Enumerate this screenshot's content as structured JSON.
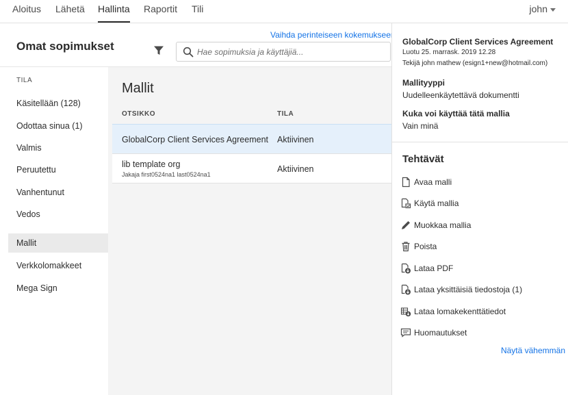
{
  "nav": {
    "tabs": [
      {
        "label": "Aloitus"
      },
      {
        "label": "Lähetä"
      },
      {
        "label": "Hallinta"
      },
      {
        "label": "Raportit"
      },
      {
        "label": "Tili"
      }
    ],
    "active_tab": "Hallinta",
    "user": "john"
  },
  "header": {
    "title": "Omat sopimukset",
    "switch_link": "Vaihda perinteiseen kokemukseen",
    "search_placeholder": "Hae sopimuksia ja käyttäjiä..."
  },
  "sidebar": {
    "section_label": "TILA",
    "items": [
      {
        "label": "Käsitellään (128)"
      },
      {
        "label": "Odottaa sinua (1)"
      },
      {
        "label": "Valmis"
      },
      {
        "label": "Peruutettu"
      },
      {
        "label": "Vanhentunut"
      },
      {
        "label": "Vedos"
      },
      {
        "label": "Mallit"
      },
      {
        "label": "Verkkolomakkeet"
      },
      {
        "label": "Mega Sign"
      }
    ],
    "active_item": "Mallit"
  },
  "list": {
    "title": "Mallit",
    "columns": {
      "title": "OTSIKKO",
      "status": "TILA"
    },
    "rows": [
      {
        "name": "GlobalCorp Client Services Agreement",
        "sub": "",
        "status": "Aktiivinen",
        "selected": true
      },
      {
        "name": "lib template org",
        "sub": "Jakaja first0524na1 last0524na1",
        "status": "Aktiivinen",
        "selected": false
      }
    ]
  },
  "details": {
    "title": "GlobalCorp Client Services Agreement",
    "created": "Luotu 25. marrask. 2019 12.28",
    "creator": "Tekijä john mathew (esign1+new@hotmail.com)",
    "type_label": "Mallityyppi",
    "type_value": "Uudelleenkäytettävä dokumentti",
    "who_label": "Kuka voi käyttää tätä mallia",
    "who_value": "Vain minä",
    "tasks_title": "Tehtävät",
    "tasks": [
      {
        "label": "Avaa malli",
        "icon": "document-icon"
      },
      {
        "label": "Käytä mallia",
        "icon": "use-template-icon"
      },
      {
        "label": "Muokkaa mallia",
        "icon": "pencil-icon"
      },
      {
        "label": "Poista",
        "icon": "trash-icon"
      },
      {
        "label": "Lataa PDF",
        "icon": "download-pdf-icon"
      },
      {
        "label": "Lataa yksittäisiä tiedostoja (1)",
        "icon": "download-files-icon"
      },
      {
        "label": "Lataa lomakekenttätiedot",
        "icon": "download-form-data-icon"
      },
      {
        "label": "Huomautukset",
        "icon": "comment-icon"
      }
    ],
    "show_less": "Näytä vähemmän"
  },
  "colors": {
    "accent_link": "#1473e6",
    "selected_row": "#e5f0fb",
    "main_bg": "#f4f4f4"
  }
}
